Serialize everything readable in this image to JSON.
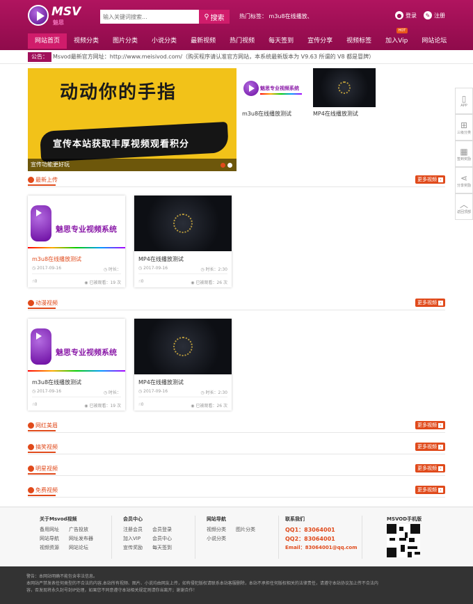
{
  "header": {
    "logo_text": "MSV",
    "logo_sub": "魅思",
    "search_placeholder": "输入关键词搜索...",
    "search_button": "搜索",
    "hot_tags_label": "热门标签：",
    "hot_tags_value": "m3u8在线播放、",
    "login": "登录",
    "register": "注册"
  },
  "nav": {
    "items": [
      {
        "label": "网站首页",
        "active": true
      },
      {
        "label": "视频分类"
      },
      {
        "label": "图片分类"
      },
      {
        "label": "小说分类"
      },
      {
        "label": "最新视频"
      },
      {
        "label": "热门视频"
      },
      {
        "label": "每天签到"
      },
      {
        "label": "宣传分享"
      },
      {
        "label": "视频标签"
      },
      {
        "label": "加入Vip",
        "badge": "HOT"
      },
      {
        "label": "网站论坛"
      }
    ]
  },
  "notice": {
    "label": "公告：",
    "text": "Msvod最新官方网址：http://www.meisivod.com/（购买程序请认准官方网站，本系统最新版本为 V9.63 所谓的 V8 都是冒牌）"
  },
  "banner": {
    "headline": "动动你的手指",
    "subline": "宣传本站获取丰厚视频观看积分",
    "caption": "宣传功能更好玩"
  },
  "promo": [
    {
      "label": "m3u8在线播放测试"
    },
    {
      "label": "MP4在线播放测试"
    }
  ],
  "thumb_logo_text": "魅思专业视频系统",
  "sections": [
    {
      "title": "最新上传",
      "more": "更多视频"
    },
    {
      "title": "动漫视频",
      "more": "更多视频"
    },
    {
      "title": "网红美眉",
      "more": "更多视频"
    },
    {
      "title": "搞笑视频",
      "more": "更多视频"
    },
    {
      "title": "明星视频",
      "more": "更多视频"
    },
    {
      "title": "免费视频",
      "more": "更多视频"
    }
  ],
  "cards_latest": [
    {
      "title": "m3u8在线播放测试",
      "date": "2017-09-16",
      "duration": "时长：",
      "likes": "0",
      "views": "已被观看：19 次"
    },
    {
      "title": "MP4在线播放测试",
      "date": "2017-09-16",
      "duration": "时长：2:30",
      "likes": "0",
      "views": "已被观看：26 次"
    }
  ],
  "cards_anime": [
    {
      "title": "m3u8在线播放测试",
      "date": "2017-09-16",
      "duration": "时长：",
      "likes": "0",
      "views": "已被观看：19 次"
    },
    {
      "title": "MP4在线播放测试",
      "date": "2017-09-16",
      "duration": "时长：2:30",
      "likes": "0",
      "views": "已被观看：26 次"
    }
  ],
  "side_tools": [
    {
      "icon": "phone-icon",
      "glyph": "▯",
      "label": "APP"
    },
    {
      "icon": "sitemap-icon",
      "glyph": "⊞",
      "label": "三级分类"
    },
    {
      "icon": "calendar-icon",
      "glyph": "▦",
      "label": "签到奖励"
    },
    {
      "icon": "share-icon",
      "glyph": "⋖",
      "label": "分享奖励"
    },
    {
      "icon": "top-icon",
      "glyph": "︿",
      "label": "返回顶部"
    }
  ],
  "footer": {
    "about": {
      "title": "关于Msvod视频",
      "rows": [
        [
          "备用网址",
          "广告投放"
        ],
        [
          "网站导航",
          "网址发布器"
        ],
        [
          "视频资源",
          "网站论坛"
        ]
      ]
    },
    "member": {
      "title": "会员中心",
      "rows": [
        [
          "注册会员",
          "会员登录"
        ],
        [
          "加入VIP",
          "会员中心"
        ],
        [
          "宣传奖励",
          "每天签到"
        ]
      ]
    },
    "sitenav": {
      "title": "网站导航",
      "rows": [
        [
          "视频分类",
          "图片分类"
        ],
        [
          "小说分类",
          ""
        ]
      ]
    },
    "contact": {
      "title": "联系我们",
      "qq1": "QQ1：83064001",
      "qq2": "QQ2：83064001",
      "email": "Email：83064001@qq.com"
    },
    "mobile": {
      "title": "MSVOD手机版"
    }
  },
  "disclaimer": {
    "line1": "警告：本网站明确不能包含非法信息。",
    "line2": "本网站严禁发表任何类型的不合法的内容,本站所有视频、图片、小说均由网友上传，如有侵犯版权请联系本站客服删除，本站不承担任何版权相关的法律责任，请遵守本站协议加上传不合法内",
    "line3": "容，否发现将永久封号封IP处理，如果您不同意遵守本站相关规定则请你当离开；谢谢合作！"
  },
  "colors": {
    "brand": "#9b0f53",
    "accent": "#e04a1b",
    "nav_active": "#d01c6b"
  }
}
